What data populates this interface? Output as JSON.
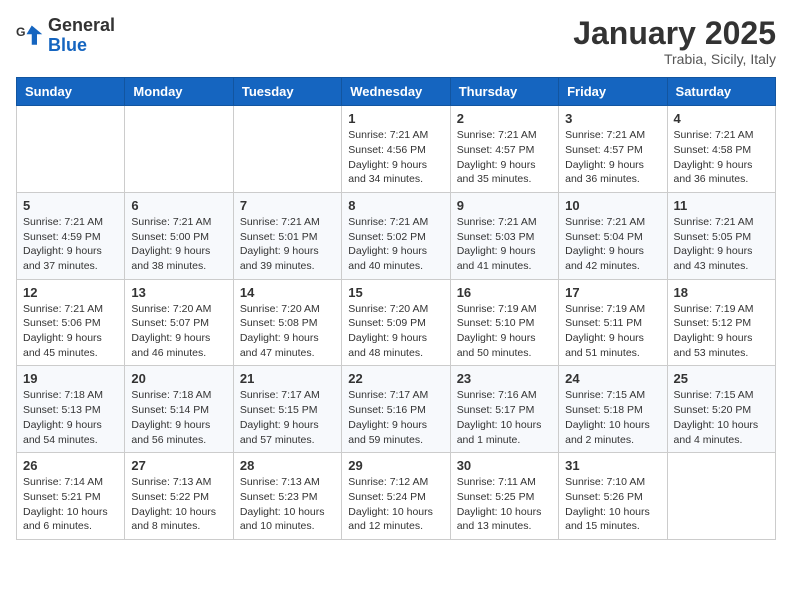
{
  "logo": {
    "general": "General",
    "blue": "Blue"
  },
  "header": {
    "month": "January 2025",
    "location": "Trabia, Sicily, Italy"
  },
  "weekdays": [
    "Sunday",
    "Monday",
    "Tuesday",
    "Wednesday",
    "Thursday",
    "Friday",
    "Saturday"
  ],
  "weeks": [
    [
      {
        "day": "",
        "info": ""
      },
      {
        "day": "",
        "info": ""
      },
      {
        "day": "",
        "info": ""
      },
      {
        "day": "1",
        "info": "Sunrise: 7:21 AM\nSunset: 4:56 PM\nDaylight: 9 hours\nand 34 minutes."
      },
      {
        "day": "2",
        "info": "Sunrise: 7:21 AM\nSunset: 4:57 PM\nDaylight: 9 hours\nand 35 minutes."
      },
      {
        "day": "3",
        "info": "Sunrise: 7:21 AM\nSunset: 4:57 PM\nDaylight: 9 hours\nand 36 minutes."
      },
      {
        "day": "4",
        "info": "Sunrise: 7:21 AM\nSunset: 4:58 PM\nDaylight: 9 hours\nand 36 minutes."
      }
    ],
    [
      {
        "day": "5",
        "info": "Sunrise: 7:21 AM\nSunset: 4:59 PM\nDaylight: 9 hours\nand 37 minutes."
      },
      {
        "day": "6",
        "info": "Sunrise: 7:21 AM\nSunset: 5:00 PM\nDaylight: 9 hours\nand 38 minutes."
      },
      {
        "day": "7",
        "info": "Sunrise: 7:21 AM\nSunset: 5:01 PM\nDaylight: 9 hours\nand 39 minutes."
      },
      {
        "day": "8",
        "info": "Sunrise: 7:21 AM\nSunset: 5:02 PM\nDaylight: 9 hours\nand 40 minutes."
      },
      {
        "day": "9",
        "info": "Sunrise: 7:21 AM\nSunset: 5:03 PM\nDaylight: 9 hours\nand 41 minutes."
      },
      {
        "day": "10",
        "info": "Sunrise: 7:21 AM\nSunset: 5:04 PM\nDaylight: 9 hours\nand 42 minutes."
      },
      {
        "day": "11",
        "info": "Sunrise: 7:21 AM\nSunset: 5:05 PM\nDaylight: 9 hours\nand 43 minutes."
      }
    ],
    [
      {
        "day": "12",
        "info": "Sunrise: 7:21 AM\nSunset: 5:06 PM\nDaylight: 9 hours\nand 45 minutes."
      },
      {
        "day": "13",
        "info": "Sunrise: 7:20 AM\nSunset: 5:07 PM\nDaylight: 9 hours\nand 46 minutes."
      },
      {
        "day": "14",
        "info": "Sunrise: 7:20 AM\nSunset: 5:08 PM\nDaylight: 9 hours\nand 47 minutes."
      },
      {
        "day": "15",
        "info": "Sunrise: 7:20 AM\nSunset: 5:09 PM\nDaylight: 9 hours\nand 48 minutes."
      },
      {
        "day": "16",
        "info": "Sunrise: 7:19 AM\nSunset: 5:10 PM\nDaylight: 9 hours\nand 50 minutes."
      },
      {
        "day": "17",
        "info": "Sunrise: 7:19 AM\nSunset: 5:11 PM\nDaylight: 9 hours\nand 51 minutes."
      },
      {
        "day": "18",
        "info": "Sunrise: 7:19 AM\nSunset: 5:12 PM\nDaylight: 9 hours\nand 53 minutes."
      }
    ],
    [
      {
        "day": "19",
        "info": "Sunrise: 7:18 AM\nSunset: 5:13 PM\nDaylight: 9 hours\nand 54 minutes."
      },
      {
        "day": "20",
        "info": "Sunrise: 7:18 AM\nSunset: 5:14 PM\nDaylight: 9 hours\nand 56 minutes."
      },
      {
        "day": "21",
        "info": "Sunrise: 7:17 AM\nSunset: 5:15 PM\nDaylight: 9 hours\nand 57 minutes."
      },
      {
        "day": "22",
        "info": "Sunrise: 7:17 AM\nSunset: 5:16 PM\nDaylight: 9 hours\nand 59 minutes."
      },
      {
        "day": "23",
        "info": "Sunrise: 7:16 AM\nSunset: 5:17 PM\nDaylight: 10 hours\nand 1 minute."
      },
      {
        "day": "24",
        "info": "Sunrise: 7:15 AM\nSunset: 5:18 PM\nDaylight: 10 hours\nand 2 minutes."
      },
      {
        "day": "25",
        "info": "Sunrise: 7:15 AM\nSunset: 5:20 PM\nDaylight: 10 hours\nand 4 minutes."
      }
    ],
    [
      {
        "day": "26",
        "info": "Sunrise: 7:14 AM\nSunset: 5:21 PM\nDaylight: 10 hours\nand 6 minutes."
      },
      {
        "day": "27",
        "info": "Sunrise: 7:13 AM\nSunset: 5:22 PM\nDaylight: 10 hours\nand 8 minutes."
      },
      {
        "day": "28",
        "info": "Sunrise: 7:13 AM\nSunset: 5:23 PM\nDaylight: 10 hours\nand 10 minutes."
      },
      {
        "day": "29",
        "info": "Sunrise: 7:12 AM\nSunset: 5:24 PM\nDaylight: 10 hours\nand 12 minutes."
      },
      {
        "day": "30",
        "info": "Sunrise: 7:11 AM\nSunset: 5:25 PM\nDaylight: 10 hours\nand 13 minutes."
      },
      {
        "day": "31",
        "info": "Sunrise: 7:10 AM\nSunset: 5:26 PM\nDaylight: 10 hours\nand 15 minutes."
      },
      {
        "day": "",
        "info": ""
      }
    ]
  ]
}
